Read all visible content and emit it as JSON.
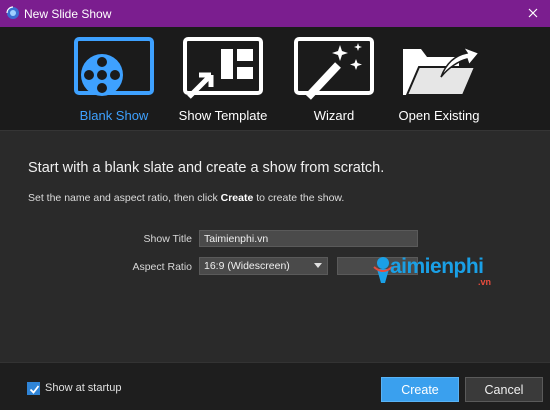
{
  "window": {
    "title": "New Slide Show"
  },
  "modes": [
    {
      "label": "Blank Show",
      "icon": "blank-show-icon"
    },
    {
      "label": "Show Template",
      "icon": "show-template-icon"
    },
    {
      "label": "Wizard",
      "icon": "wizard-icon"
    },
    {
      "label": "Open Existing",
      "icon": "open-existing-icon"
    }
  ],
  "active_mode": "Blank Show",
  "main": {
    "headline": "Start with a blank slate and create a show from scratch.",
    "instruction_pre": "Set the name and aspect ratio, then click ",
    "instruction_bold": "Create",
    "instruction_post": " to create the show."
  },
  "form": {
    "show_title_label": "Show Title",
    "show_title_value": "Taimienphi.vn",
    "aspect_ratio_label": "Aspect Ratio",
    "aspect_ratio_value": "16:9 (Widescreen)"
  },
  "watermark": {
    "text": "aimienphi",
    "sub": ".vn"
  },
  "footer": {
    "show_at_startup_label": "Show at startup",
    "show_at_startup_checked": true,
    "create_label": "Create",
    "cancel_label": "Cancel"
  },
  "colors": {
    "titlebar": "#7b1e8f",
    "accent": "#3aa0ee",
    "active_label": "#3ea1ff"
  }
}
